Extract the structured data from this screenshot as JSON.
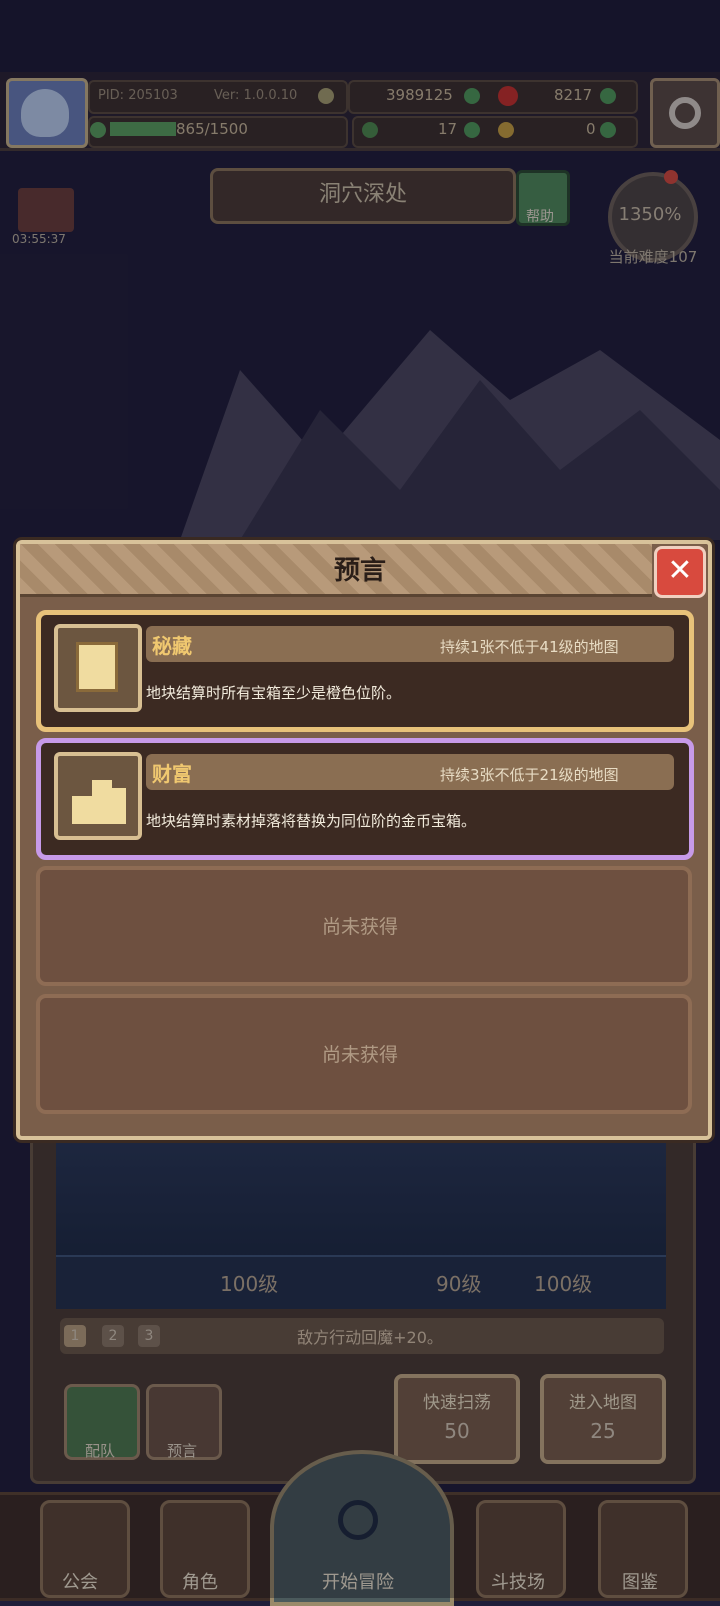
{
  "hud": {
    "pid": "PID: 205103",
    "version": "Ver: 1.0.0.10",
    "gold": "3989125",
    "gems": "8217",
    "exp": "865/1500",
    "clover": "17",
    "crystal": "0"
  },
  "location": {
    "name": "洞穴深处",
    "help_label": "帮助",
    "timer": "03:55:37",
    "clock_percent": "1350%",
    "difficulty": "当前难度107"
  },
  "modal": {
    "title": "预言",
    "close": "✕",
    "cards": [
      {
        "name": "秘藏",
        "requirement": "持续1张不低于41级的地图",
        "description": "地块结算时所有宝箱至少是橙色位阶。"
      },
      {
        "name": "财富",
        "requirement": "持续3张不低于21级的地图",
        "description": "地块结算时素材掉落将替换为同位阶的金币宝箱。"
      }
    ],
    "empty_slots": [
      "尚未获得",
      "尚未获得"
    ]
  },
  "stage": {
    "levels": [
      "100级",
      "90级",
      "100级"
    ],
    "pages": [
      "1",
      "2",
      "3"
    ],
    "effect": "敌方行动回魔+20。",
    "buttons": {
      "team": "配队",
      "prophecy": "预言",
      "sweep": "快速扫荡",
      "sweep_cost": "50",
      "enter": "进入地图",
      "enter_cost": "25"
    }
  },
  "nav": {
    "guild": "公会",
    "role": "角色",
    "start": "开始冒险",
    "arena": "斗技场",
    "codex": "图鉴"
  },
  "colors": {
    "background": "#1f1d39",
    "gold_frame": "#e8c27a",
    "purple_frame": "#c79ae8",
    "card_title": "#f0c870"
  }
}
